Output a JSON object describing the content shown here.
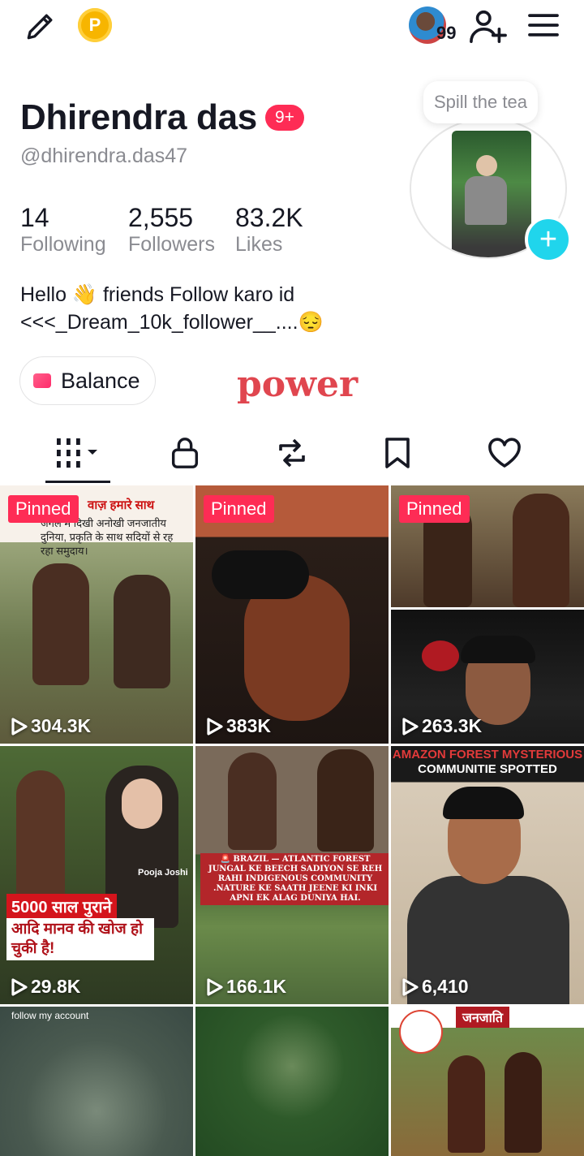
{
  "header": {
    "notification_count": "99",
    "icons": [
      "edit-icon",
      "coin-icon",
      "add-user-icon",
      "menu-icon"
    ],
    "coin_letter": "P"
  },
  "profile": {
    "name": "Dhirendra das",
    "badge": "9+",
    "handle": "@dhirendra.das47",
    "story_bubble": "Spill the tea"
  },
  "stats": [
    {
      "value": "14",
      "label": "Following"
    },
    {
      "value": "2,555",
      "label": "Followers"
    },
    {
      "value": "83.2K",
      "label": "Likes"
    }
  ],
  "bio": {
    "line1": "Hello 👋 friends Follow karo id",
    "line2": "<<<_Dream_10k_follower__....😔"
  },
  "balance_label": "Balance",
  "power_text": "power",
  "tabs": [
    "videos-tab",
    "private-tab",
    "reposts-tab",
    "favorites-tab",
    "liked-tab"
  ],
  "videos": [
    {
      "views": "304.3K",
      "pinned": "Pinned",
      "overlay": "वाज़ हमारे साथ",
      "overlay2": "जंगल में दिखी अनोखी जनजातीय दुनिया, प्रकृति के साथ सदियों से रह रहा समुदाय।"
    },
    {
      "views": "383K",
      "pinned": "Pinned"
    },
    {
      "views": "263.3K",
      "pinned": "Pinned"
    },
    {
      "views": "29.8K",
      "overlay": "5000 साल पुराने",
      "overlay2": "आदि मानव की खोज हो चुकी है!",
      "overlay3": "Pooja Joshi"
    },
    {
      "views": "166.1K",
      "overlay": "🚨 BRAZIL — ATLANTIC FOREST JUNGAL KE BEECH SADIYON SE REH RAHI INDIGENOUS COMMUNITY .NATURE KE SAATH JEENE KI INKI APNI EK ALAG DUNIYA HAI."
    },
    {
      "views": "6,410",
      "overlay": "AMAZON FOREST MYSTERIOUS",
      "overlay2": "COMMUNITIE SPOTTED"
    },
    {
      "views": "",
      "overlay": "follow my account"
    },
    {
      "views": ""
    },
    {
      "views": "",
      "overlay": "जनजाति"
    }
  ]
}
